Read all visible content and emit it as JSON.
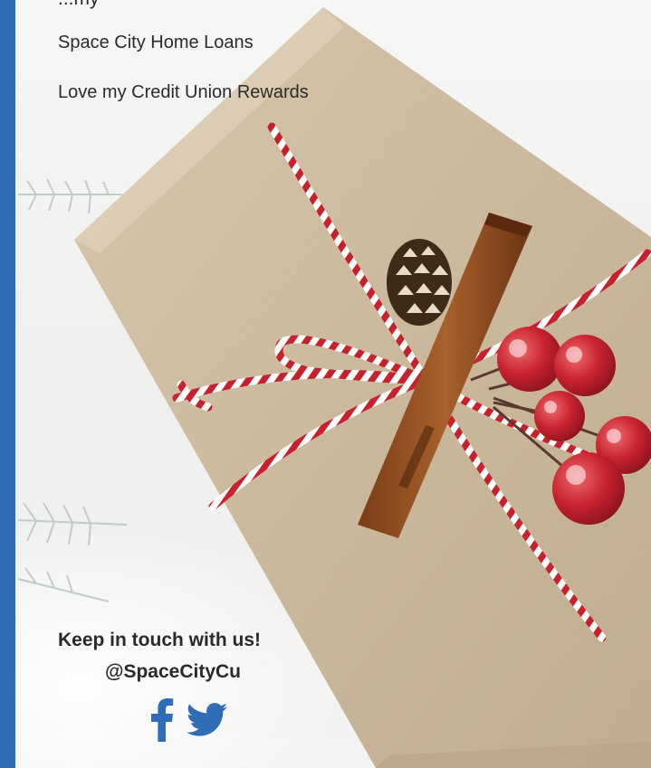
{
  "links": [
    {
      "label": "Space City Home Loans"
    },
    {
      "label": "Love my Credit Union Rewards"
    }
  ],
  "cutoff_text": "...my",
  "contact": {
    "heading": "Keep in touch with us!",
    "handle": "@SpaceCityCu"
  },
  "social": [
    {
      "icon": "facebook-icon"
    },
    {
      "icon": "twitter-icon"
    }
  ],
  "colors": {
    "accent": "#2f6db7",
    "text": "#2b2b2b",
    "twine_red": "#c8212e",
    "paper": "#c9b79c"
  }
}
